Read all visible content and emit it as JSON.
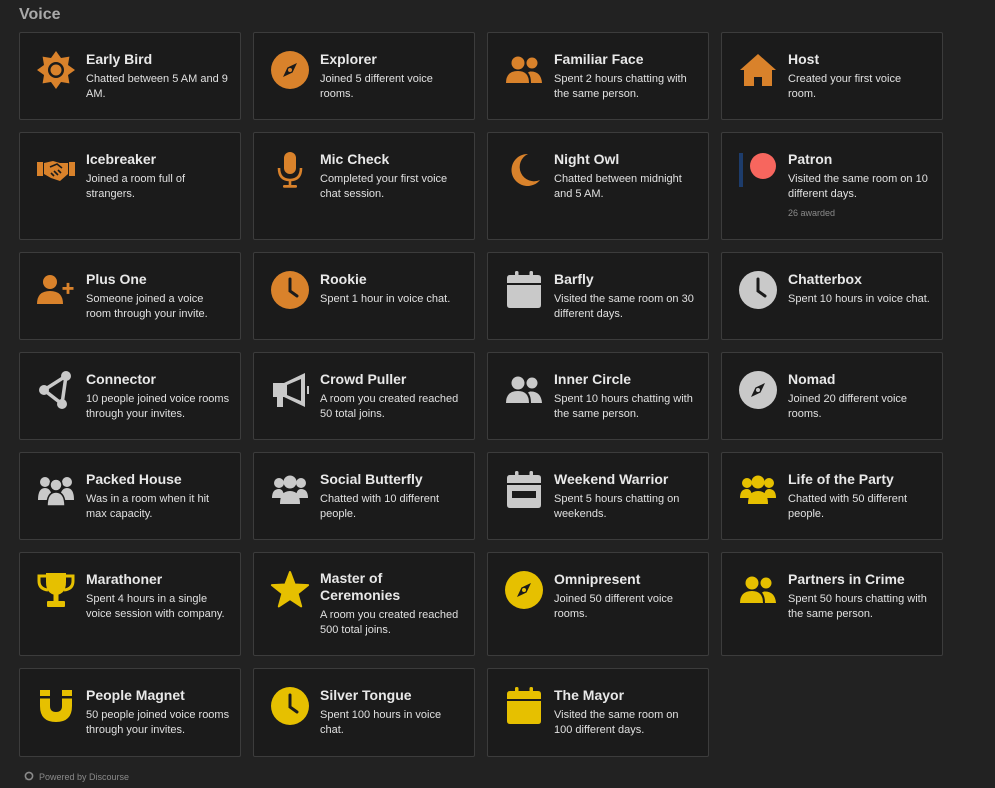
{
  "section_title": "Voice",
  "footer": {
    "label": "Powered by Discourse"
  },
  "colors": {
    "bronze": "#d9822b",
    "silver": "#c9c9c9",
    "gold": "#e6c000",
    "patron_red": "#f7665e",
    "patron_bar": "#1d3c6b"
  },
  "badges": [
    {
      "name": "Early Bird",
      "desc": "Chatted between 5 AM and 9 AM.",
      "icon": "sun-icon",
      "tier": "bronze"
    },
    {
      "name": "Explorer",
      "desc": "Joined 5 different voice rooms.",
      "icon": "compass-icon",
      "tier": "bronze"
    },
    {
      "name": "Familiar Face",
      "desc": "Spent 2 hours chatting with the same person.",
      "icon": "user-friends-icon",
      "tier": "bronze"
    },
    {
      "name": "Host",
      "desc": "Created your first voice room.",
      "icon": "home-icon",
      "tier": "bronze"
    },
    {
      "name": "Icebreaker",
      "desc": "Joined a room full of strangers.",
      "icon": "handshake-icon",
      "tier": "bronze"
    },
    {
      "name": "Mic Check",
      "desc": "Completed your first voice chat session.",
      "icon": "microphone-icon",
      "tier": "bronze"
    },
    {
      "name": "Night Owl",
      "desc": "Chatted between midnight and 5 AM.",
      "icon": "moon-icon",
      "tier": "bronze"
    },
    {
      "name": "Patron",
      "desc": "Visited the same room on 10 different days.",
      "extra": "26 awarded",
      "icon": "patreon-icon",
      "tier": "patron"
    },
    {
      "name": "Plus One",
      "desc": "Someone joined a voice room through your invite.",
      "icon": "user-plus-icon",
      "tier": "bronze"
    },
    {
      "name": "Rookie",
      "desc": "Spent 1 hour in voice chat.",
      "icon": "clock-icon",
      "tier": "bronze"
    },
    {
      "name": "Barfly",
      "desc": "Visited the same room on 30 different days.",
      "icon": "calendar-icon",
      "tier": "silver"
    },
    {
      "name": "Chatterbox",
      "desc": "Spent 10 hours in voice chat.",
      "icon": "clock-icon",
      "tier": "silver"
    },
    {
      "name": "Connector",
      "desc": "10 people joined voice rooms through your invites.",
      "icon": "network-icon",
      "tier": "silver"
    },
    {
      "name": "Crowd Puller",
      "desc": "A room you created reached 50 total joins.",
      "icon": "bullhorn-icon",
      "tier": "silver"
    },
    {
      "name": "Inner Circle",
      "desc": "Spent 10 hours chatting with the same person.",
      "icon": "user-friends-icon",
      "tier": "silver"
    },
    {
      "name": "Nomad",
      "desc": "Joined 20 different voice rooms.",
      "icon": "compass-icon",
      "tier": "silver"
    },
    {
      "name": "Packed House",
      "desc": "Was in a room when it hit max capacity.",
      "icon": "crowd-icon",
      "tier": "silver"
    },
    {
      "name": "Social Butterfly",
      "desc": "Chatted with 10 different people.",
      "icon": "users-icon",
      "tier": "silver"
    },
    {
      "name": "Weekend Warrior",
      "desc": "Spent 5 hours chatting on weekends.",
      "icon": "calendar-week-icon",
      "tier": "silver"
    },
    {
      "name": "Life of the Party",
      "desc": "Chatted with 50 different people.",
      "icon": "users-icon",
      "tier": "gold"
    },
    {
      "name": "Marathoner",
      "desc": "Spent 4 hours in a single voice session with company.",
      "icon": "trophy-icon",
      "tier": "gold"
    },
    {
      "name": "Master of Ceremonies",
      "desc": "A room you created reached 500 total joins.",
      "icon": "star-icon",
      "tier": "gold"
    },
    {
      "name": "Omnipresent",
      "desc": "Joined 50 different voice rooms.",
      "icon": "compass-icon",
      "tier": "gold"
    },
    {
      "name": "Partners in Crime",
      "desc": "Spent 50 hours chatting with the same person.",
      "icon": "user-friends-icon",
      "tier": "gold"
    },
    {
      "name": "People Magnet",
      "desc": "50 people joined voice rooms through your invites.",
      "icon": "magnet-icon",
      "tier": "gold"
    },
    {
      "name": "Silver Tongue",
      "desc": "Spent 100 hours in voice chat.",
      "icon": "clock-icon",
      "tier": "gold"
    },
    {
      "name": "The Mayor",
      "desc": "Visited the same room on 100 different days.",
      "icon": "calendar-icon",
      "tier": "gold"
    }
  ]
}
